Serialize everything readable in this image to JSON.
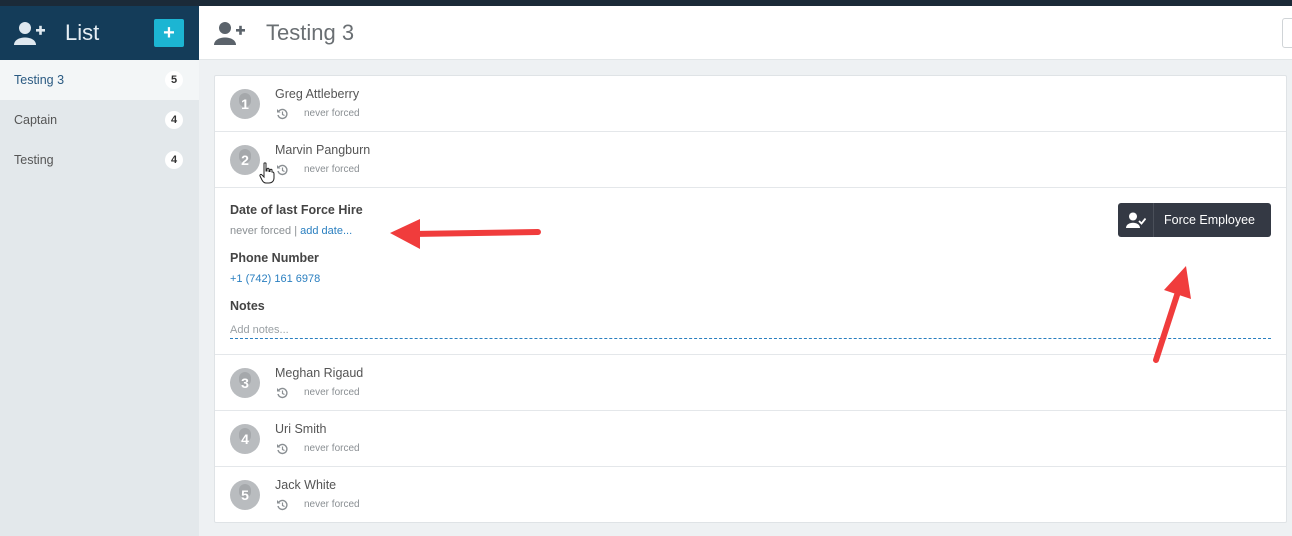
{
  "sidebar": {
    "title": "List",
    "add_label": "+",
    "items": [
      {
        "label": "Testing 3",
        "count": "5"
      },
      {
        "label": "Captain",
        "count": "4"
      },
      {
        "label": "Testing",
        "count": "4"
      }
    ]
  },
  "header": {
    "title": "Testing 3"
  },
  "employees": [
    {
      "rank": "1",
      "name": "Greg Attleberry",
      "status": "never forced"
    },
    {
      "rank": "2",
      "name": "Marvin Pangburn",
      "status": "never forced"
    },
    {
      "rank": "3",
      "name": "Meghan Rigaud",
      "status": "never forced"
    },
    {
      "rank": "4",
      "name": "Uri Smith",
      "status": "never forced"
    },
    {
      "rank": "5",
      "name": "Jack White",
      "status": "never forced"
    }
  ],
  "detail": {
    "last_force_label": "Date of last Force Hire",
    "last_force_value": "never forced",
    "separator": "|",
    "add_date_link": "add date...",
    "phone_label": "Phone Number",
    "phone_value": "+1 (742) 161 6978",
    "notes_label": "Notes",
    "notes_placeholder": "Add notes...",
    "force_button": "Force Employee"
  },
  "colors": {
    "accent": "#1cb5d3",
    "sidebar_header": "#143c59",
    "link": "#2a7fc0",
    "annotation_arrow": "#f03c3c"
  }
}
